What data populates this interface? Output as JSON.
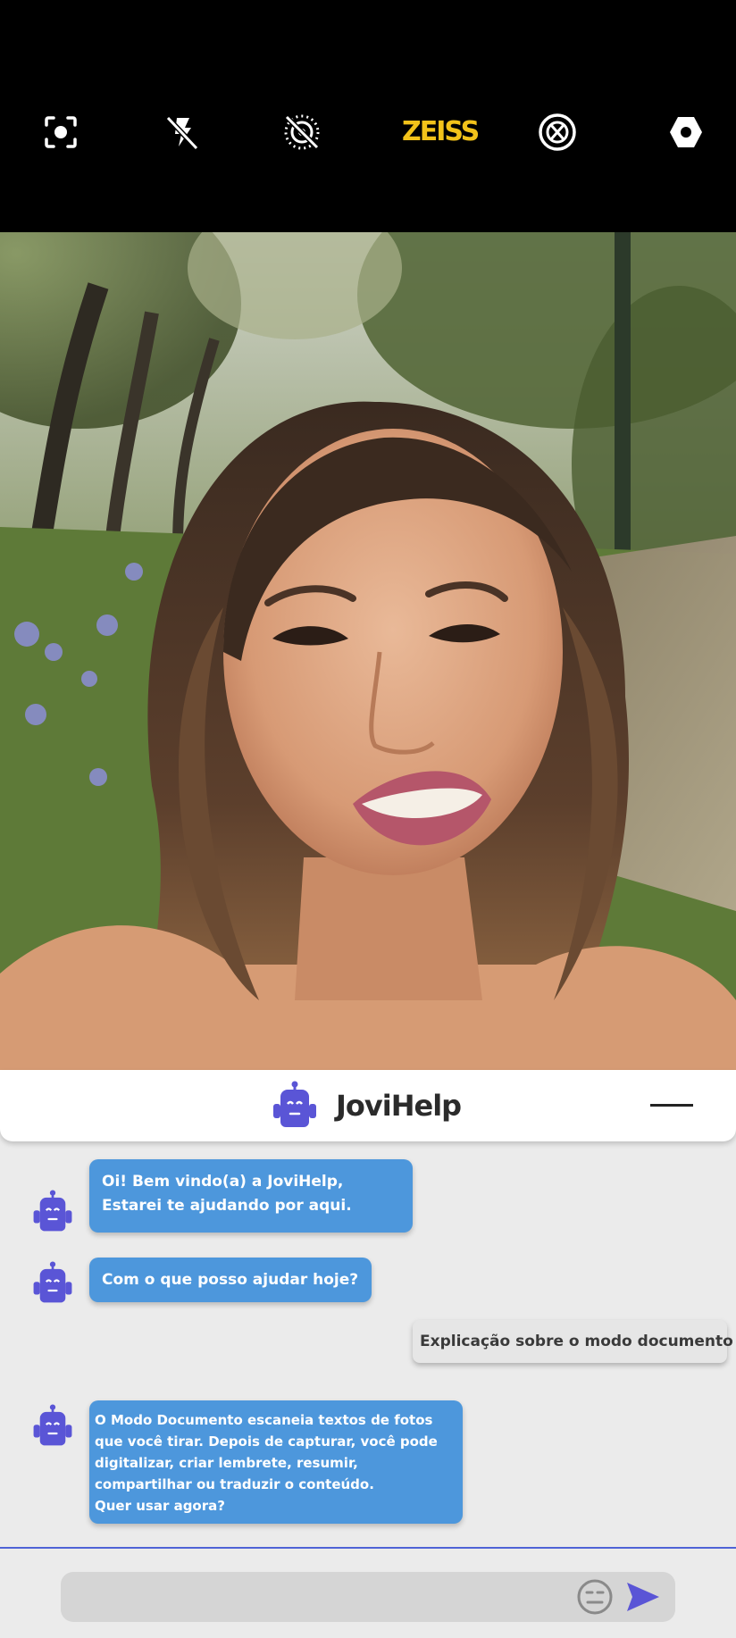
{
  "camera_bar": {
    "brand_label": "ZEISS",
    "brand_color": "#f2c21a",
    "icons": [
      "focus-frame-icon",
      "flash-off-icon",
      "live-photo-off-icon",
      "filter-off-icon",
      "settings-hexagon-icon"
    ]
  },
  "chat": {
    "header": {
      "title": "JoviHelp"
    },
    "messages": [
      {
        "from": "bot",
        "text": "Oi! Bem vindo(a) a JoviHelp, Estarei te ajudando por aqui."
      },
      {
        "from": "bot",
        "text": "Com o que posso ajudar hoje?"
      },
      {
        "from": "user",
        "text": "Explicação sobre o modo documento"
      },
      {
        "from": "bot",
        "text": "O Modo Documento escaneia textos de fotos que você tirar. Depois de capturar, você pode digitalizar, criar lembrete, resumir, compartilhar ou traduzir o conteúdo.\nQuer usar agora?"
      }
    ],
    "composer": {
      "placeholder": ""
    },
    "accent_color": "#4d97dc",
    "robot_color": "#5a55d6"
  }
}
